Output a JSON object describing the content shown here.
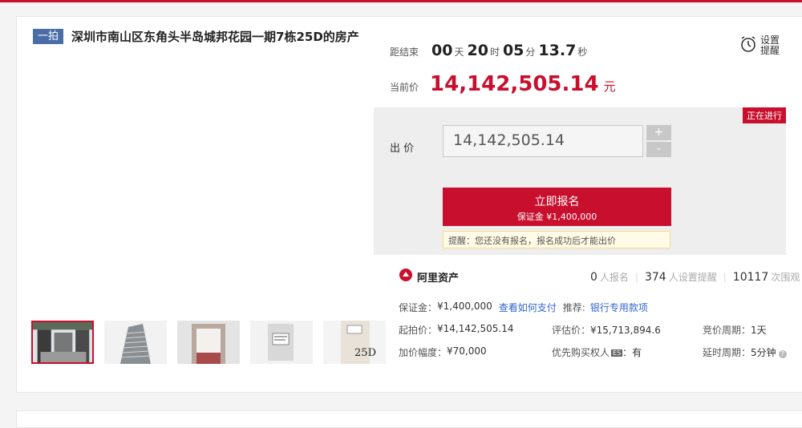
{
  "header": {
    "badge": "一拍",
    "title": "深圳市南山区东角头半岛城邦花园一期7栋25D的房产"
  },
  "countdown": {
    "label": "距结束",
    "days": "00",
    "days_unit": "天",
    "hours": "20",
    "hours_unit": "时",
    "minutes": "05",
    "minutes_unit": "分",
    "seconds": "13.7",
    "seconds_unit": "秒"
  },
  "current_price": {
    "label": "当前价",
    "value": "14,142,505.14",
    "unit": "元"
  },
  "reminder": {
    "line1": "设置",
    "line2": "提醒",
    "icon": "alarm-clock-icon"
  },
  "bid": {
    "status": "正在进行",
    "label": "出 价",
    "value": "14,142,505.14",
    "plus": "+",
    "minus": "-",
    "signup_label": "立即报名",
    "deposit_line": "保证金 ¥1,400,000",
    "tip": "提醒：您还没有报名，报名成功后才能出价"
  },
  "provider": {
    "name": "阿里资产",
    "icon": "ali-assets-logo-icon"
  },
  "stats": {
    "signup_count": "0",
    "signup_label": "人报名",
    "reminder_count": "374",
    "reminder_label": "人设置提醒",
    "view_count": "10117",
    "view_label": "次围观"
  },
  "info": {
    "deposit_key": "保证金",
    "deposit_val": "¥1,400,000",
    "pay_link": "查看如何支付",
    "recommend_key": "推荐:",
    "recommend_link": "银行专用款项",
    "start_price_key": "起拍价",
    "start_price_val": "¥14,142,505.14",
    "appraisal_key": "评估价",
    "appraisal_val": "¥15,713,894.6",
    "cycle_key": "竞价周期",
    "cycle_val": "1天",
    "increment_key": "加价幅度",
    "increment_val": "¥70,000",
    "priority_key": "优先购买权人",
    "priority_badge": "ES",
    "priority_val": "有",
    "delay_key": "延时周期",
    "delay_val": "5分钟",
    "colon": "："
  },
  "thumbnails": [
    {
      "name": "thumb-entrance",
      "selected": true
    },
    {
      "name": "thumb-building"
    },
    {
      "name": "thumb-lobby"
    },
    {
      "name": "thumb-sign"
    },
    {
      "name": "thumb-door",
      "label": "25D"
    }
  ],
  "colors": {
    "accent": "#c8102e",
    "badge": "#4a6da7",
    "link": "#3366cc"
  }
}
